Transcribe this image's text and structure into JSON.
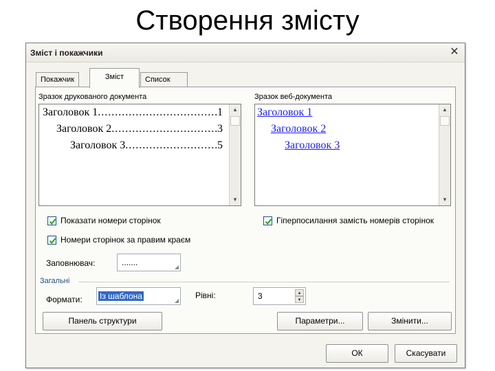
{
  "slide": {
    "title": "Створення змісту"
  },
  "dialog": {
    "title": "Зміст і покажчики",
    "close_glyph": "✕",
    "tabs": [
      {
        "label": "Покажчик",
        "active": false
      },
      {
        "label": "Зміст",
        "active": true
      },
      {
        "label": "Список ілюстрацій",
        "active": false
      }
    ],
    "print_preview": {
      "label": "Зразок друкованого документа",
      "lines": [
        {
          "text": "Заголовок 1",
          "dots": "..........................................",
          "page": "1"
        },
        {
          "text": "Заголовок 2",
          "dots": "..........................................",
          "page": "3"
        },
        {
          "text": "Заголовок 3",
          "dots": "..........................................",
          "page": "5"
        }
      ]
    },
    "web_preview": {
      "label": "Зразок веб-документа",
      "links": [
        "Заголовок 1",
        "Заголовок 2",
        "Заголовок 3"
      ],
      "link_color": "#1a1aff"
    },
    "options": {
      "show_page_numbers": {
        "label": "Показати номери сторінок",
        "checked": true
      },
      "right_align": {
        "label": "Номери сторінок за правим краєм",
        "checked": true
      },
      "hyperlinks": {
        "label": "Гіперпосилання замість номерів сторінок",
        "checked": true
      },
      "leader_label": "Заповнювач:",
      "leader_value": "......."
    },
    "general": {
      "label": "Загальні",
      "formats_label": "Формати:",
      "formats_value": "Із шаблона",
      "levels_label": "Рівні:",
      "levels_value": "3"
    },
    "buttons": {
      "outline_toolbar": "Панель структури",
      "options": "Параметри...",
      "modify": "Змінити...",
      "ok": "ОК",
      "cancel": "Скасувати"
    },
    "colors": {
      "selection": "#316ac5",
      "checkbox_border": "#1c5180"
    }
  }
}
